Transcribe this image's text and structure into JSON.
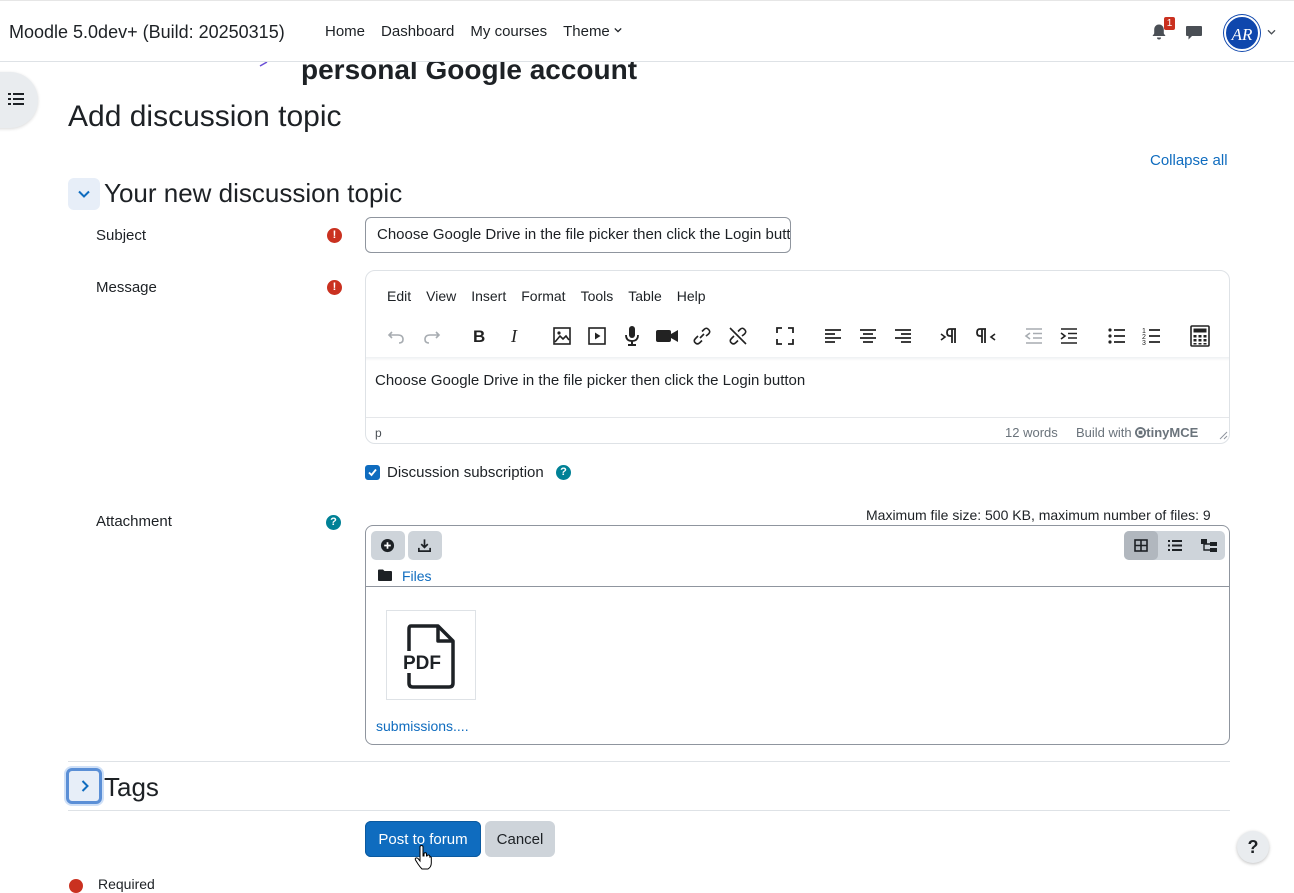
{
  "navbar": {
    "brand": "Moodle 5.0dev+ (Build: 20250315)",
    "links": [
      "Home",
      "Dashboard",
      "My courses",
      "Theme"
    ],
    "notification_count": "1",
    "avatar_initials": "AR"
  },
  "page": {
    "partial_heading": "personal Google account",
    "title": "Add discussion topic",
    "collapse_all": "Collapse all"
  },
  "section": {
    "title": "Your new discussion topic"
  },
  "form": {
    "subject_label": "Subject",
    "subject_value": "Choose Google Drive in the file picker then click the Login button",
    "message_label": "Message",
    "editor": {
      "menu": [
        "Edit",
        "View",
        "Insert",
        "Format",
        "Tools",
        "Table",
        "Help"
      ],
      "content": "Choose Google Drive in the file picker then click the Login button",
      "status_path": "p",
      "word_count": "12 words",
      "build_with": "Build with",
      "tinymce": "tinyMCE"
    },
    "subscription_label": "Discussion subscription",
    "attachment_label": "Attachment",
    "max_size": "Maximum file size: 500 KB, maximum number of files: 9",
    "files_path": "Files",
    "file_name": "submissions....",
    "file_type_label": "PDF"
  },
  "tags": {
    "title": "Tags"
  },
  "buttons": {
    "post": "Post to forum",
    "cancel": "Cancel"
  },
  "footer": {
    "required": "Required",
    "help": "?"
  }
}
